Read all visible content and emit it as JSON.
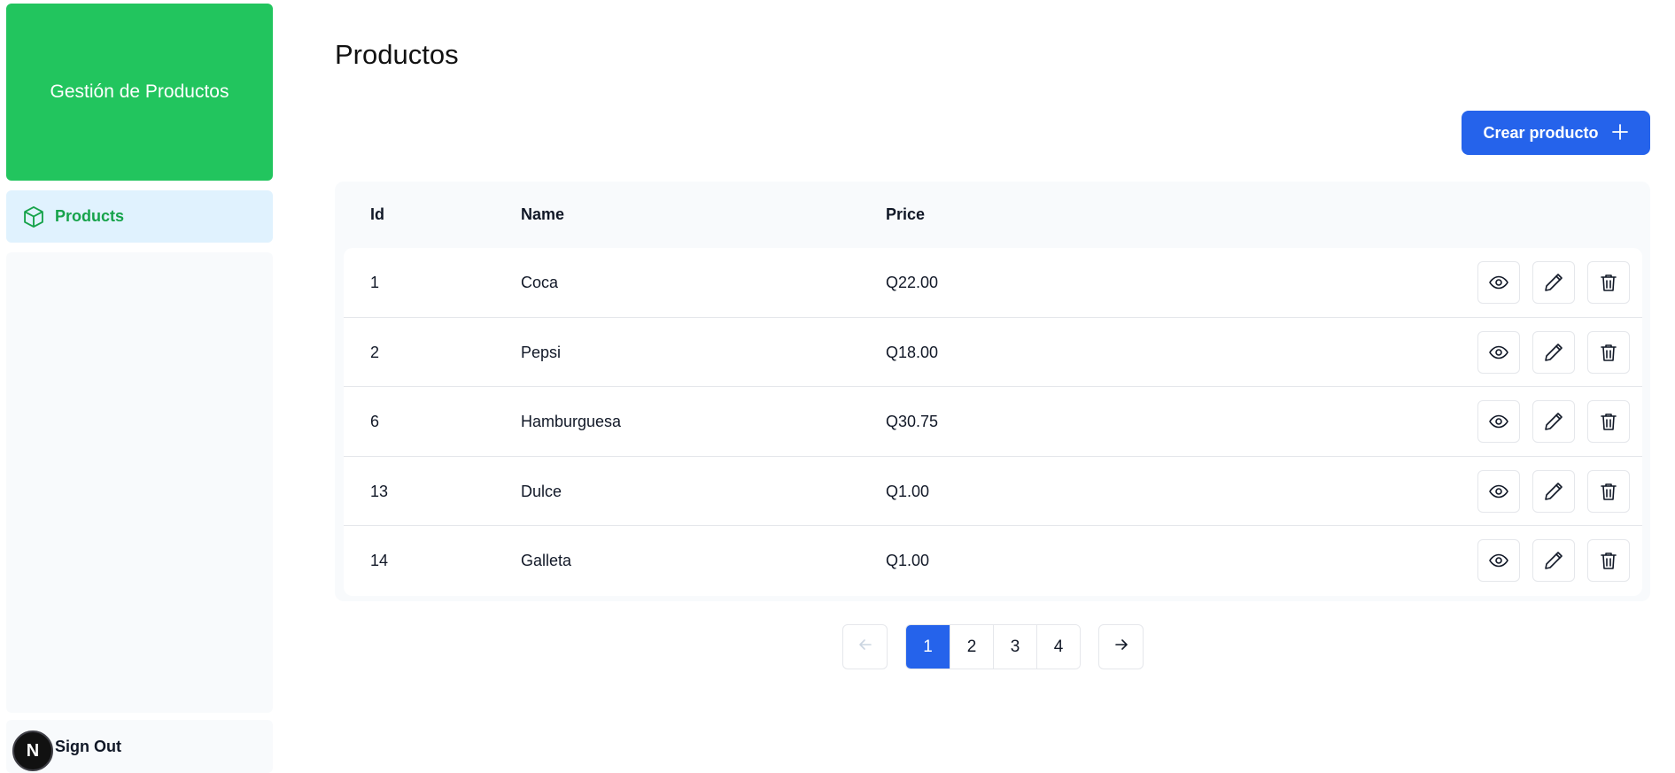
{
  "sidebar": {
    "brand_title": "Gestión de Productos",
    "nav_items": [
      {
        "label": "Products",
        "icon": "cube-icon",
        "active": true
      }
    ],
    "signout_label": "Sign Out",
    "badge_letter": "N"
  },
  "main": {
    "page_title": "Productos",
    "create_button_label": "Crear producto",
    "table": {
      "headers": {
        "id": "Id",
        "name": "Name",
        "price": "Price"
      },
      "rows": [
        {
          "id": "1",
          "name": "Coca",
          "price": "Q22.00"
        },
        {
          "id": "2",
          "name": "Pepsi",
          "price": "Q18.00"
        },
        {
          "id": "6",
          "name": "Hamburguesa",
          "price": "Q30.75"
        },
        {
          "id": "13",
          "name": "Dulce",
          "price": "Q1.00"
        },
        {
          "id": "14",
          "name": "Galleta",
          "price": "Q1.00"
        }
      ],
      "row_actions": [
        "eye-icon",
        "pencil-icon",
        "trash-icon"
      ]
    },
    "pagination": {
      "pages": [
        "1",
        "2",
        "3",
        "4"
      ],
      "current_page": "1"
    }
  },
  "colors": {
    "brand_green": "#22c55e",
    "primary_blue": "#2563eb",
    "nav_active_bg": "#e0f2fe",
    "nav_active_text": "#16a34a"
  }
}
